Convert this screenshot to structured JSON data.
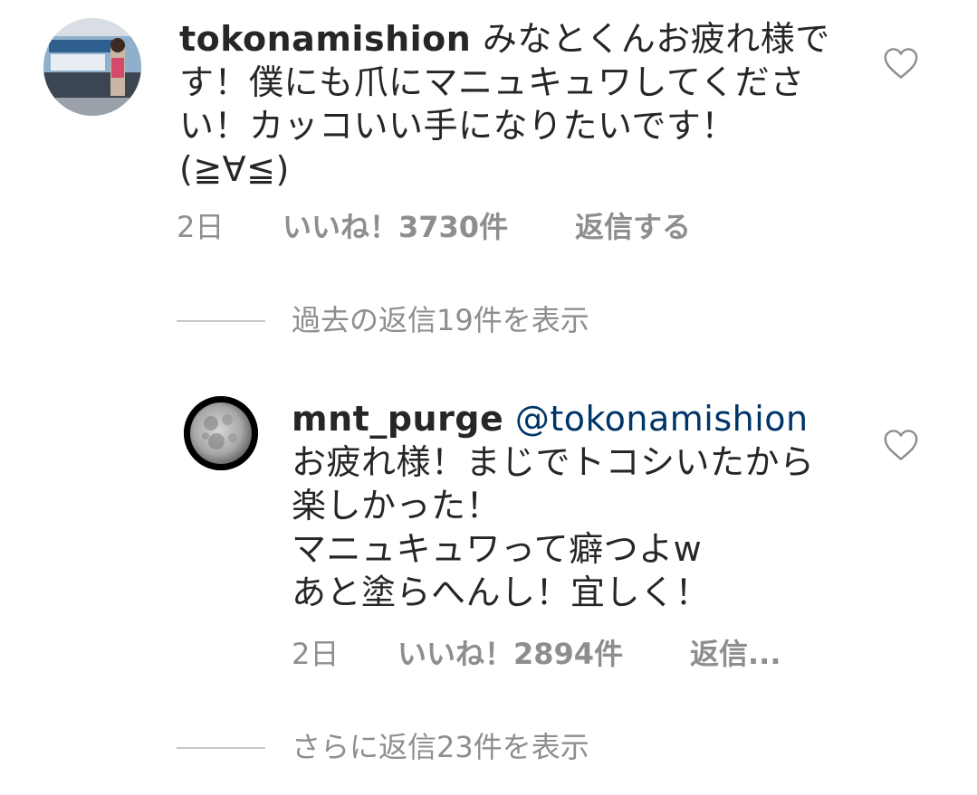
{
  "comment": {
    "username": "tokonamishion",
    "text": "みなとくんお疲れ様です！僕にも爪にマニュキュワしてください！カッコいい手になりたいです！(≧∀≦)",
    "time": "2日",
    "likes": "いいね！3730件",
    "reply": "返信する"
  },
  "view_previous": "過去の返信19件を表示",
  "reply": {
    "username": "mnt_purge",
    "mention": "@tokonamishion",
    "text": "お疲れ様！まじでトコシいたから楽しかった！\nマニュキュワって癖つよw\nあと塗らへんし！宜しく！",
    "time": "2日",
    "likes": "いいね！2894件",
    "reply": "返信..."
  },
  "view_more": "さらに返信23件を表示",
  "icons": {
    "like": "heart-outline-icon"
  },
  "colors": {
    "text": "#262626",
    "meta": "#8e8e8e",
    "mention": "#003569",
    "divider": "#c7c7c7"
  }
}
